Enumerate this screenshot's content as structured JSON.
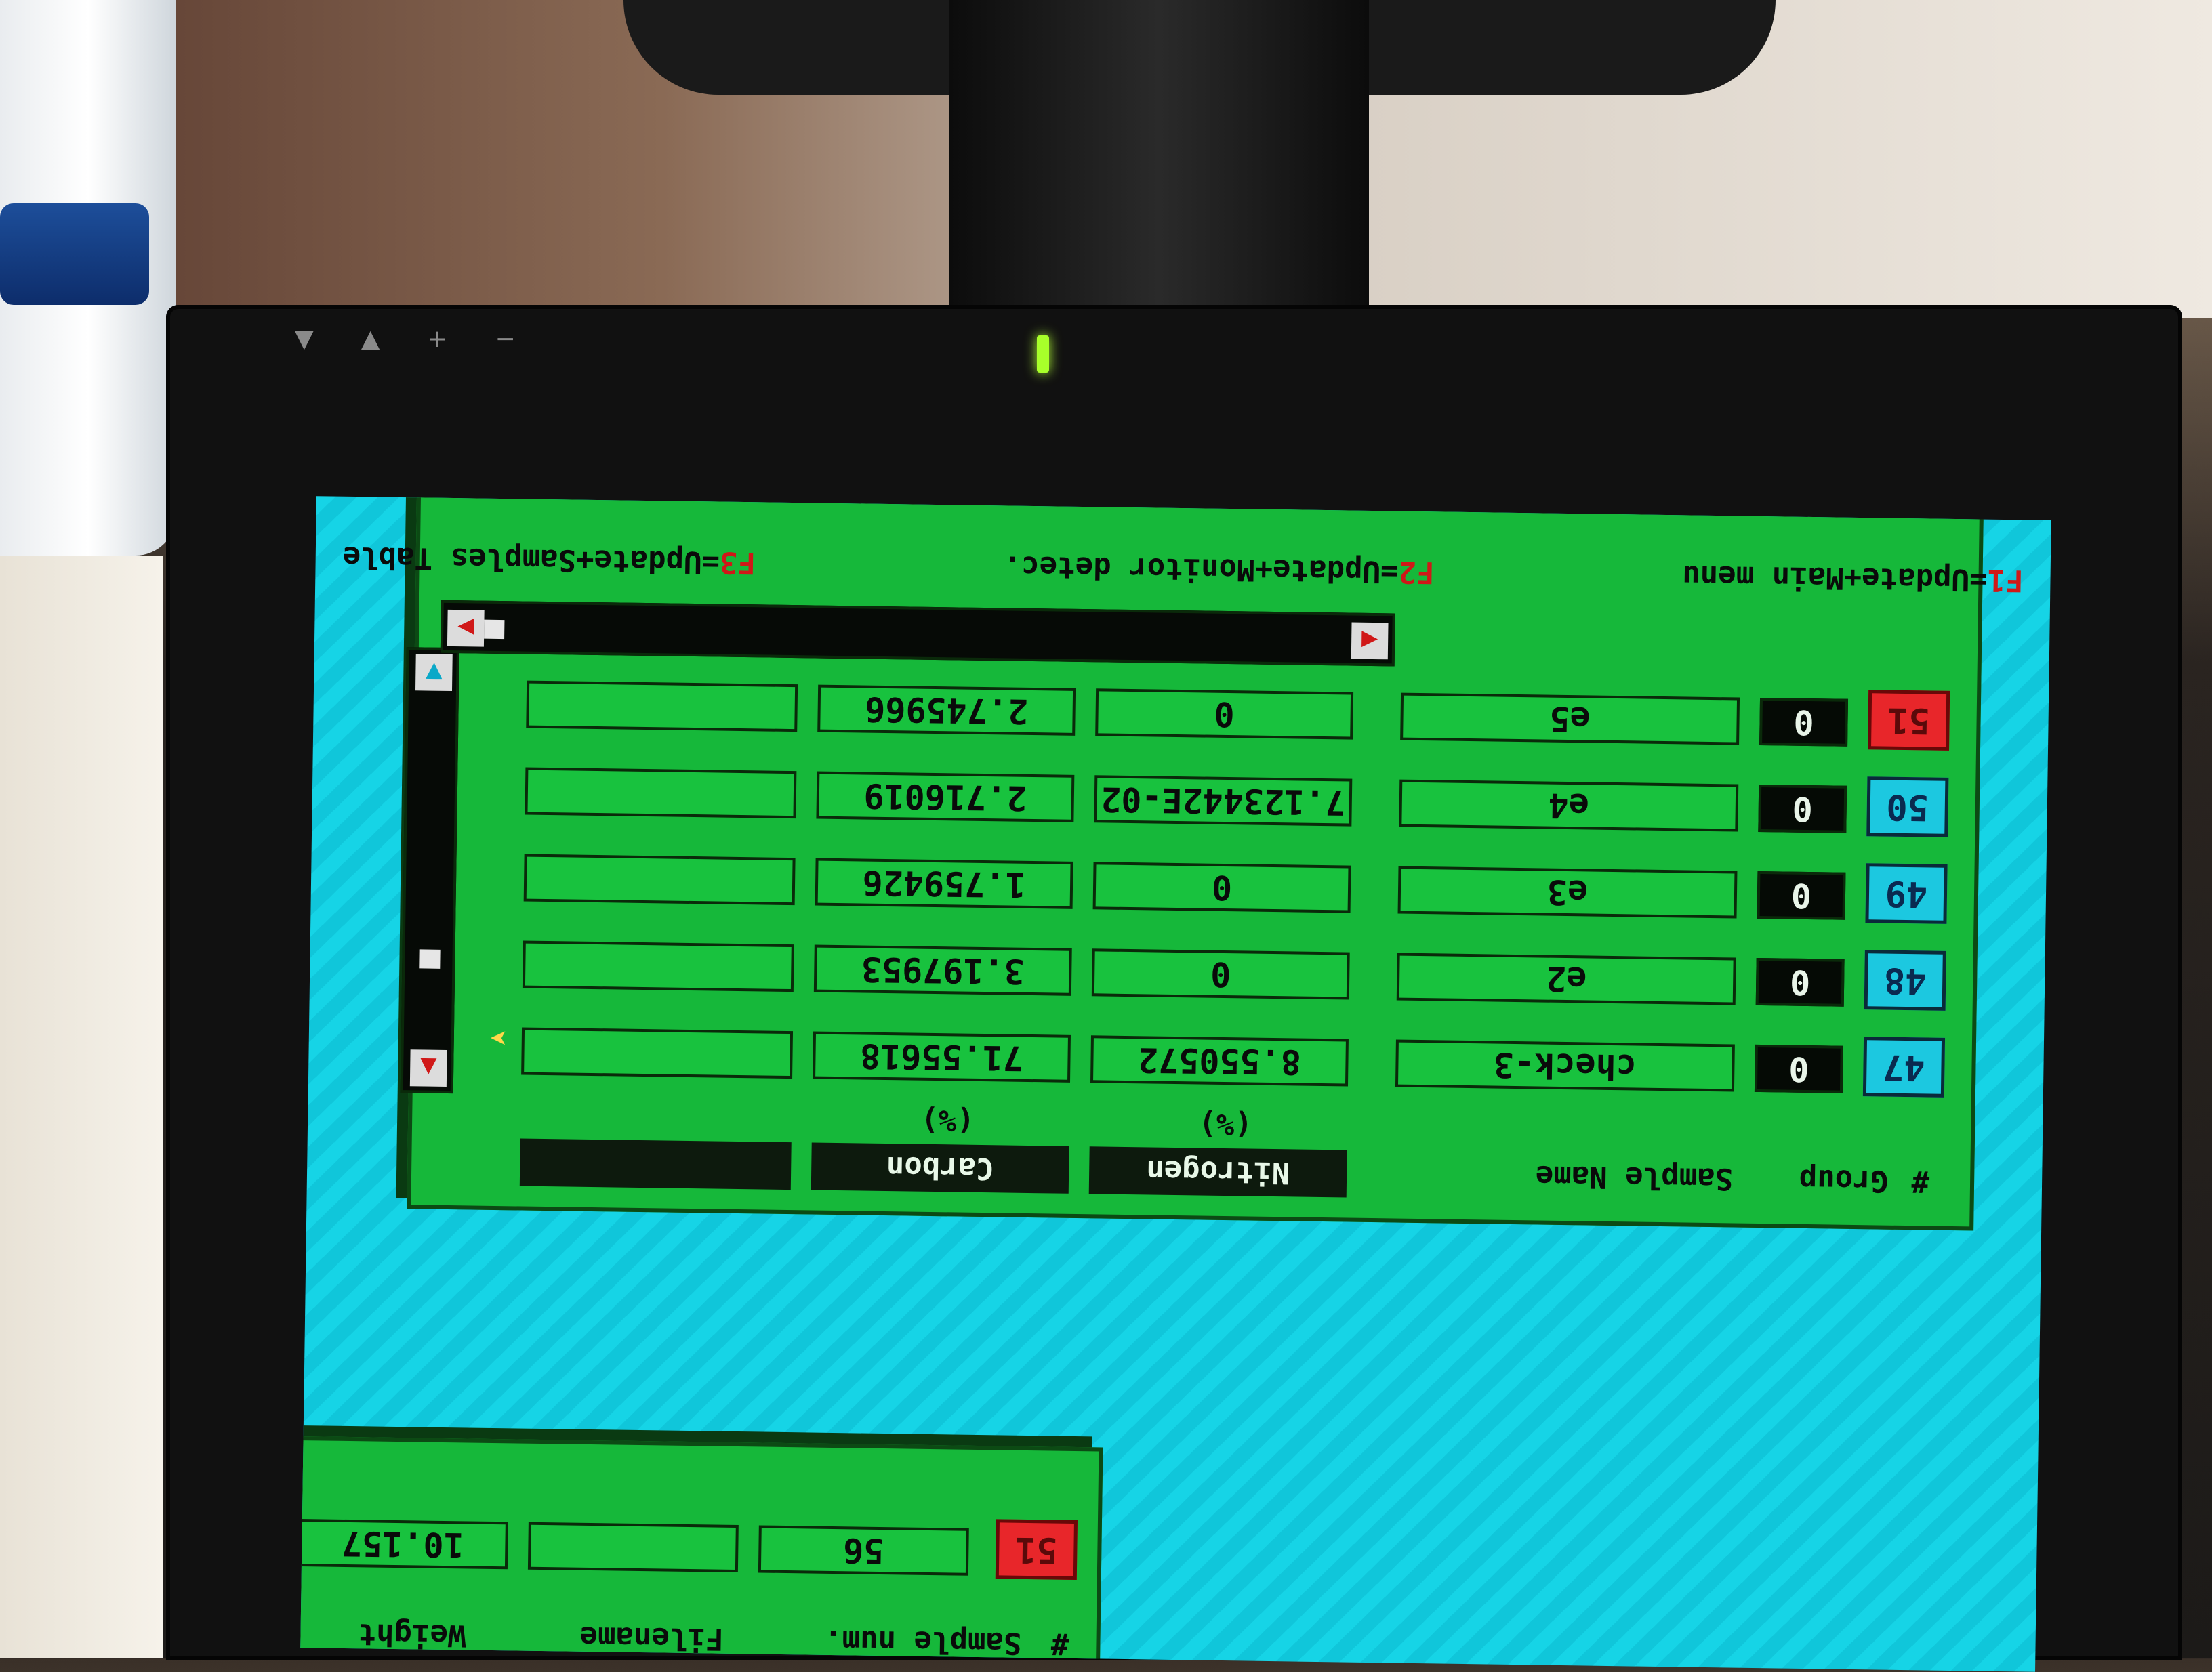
{
  "function_keys": [
    {
      "key": "F1",
      "text": "=Update+Main menu"
    },
    {
      "key": "F2",
      "text": "=Update+Monitor detec."
    },
    {
      "key": "F3",
      "text": "=Update+Samples Table"
    }
  ],
  "table": {
    "headers": {
      "num": "#",
      "group": "Group",
      "sample_name": "Sample Name",
      "col1": "Nitrogen",
      "col1_unit": "(%)",
      "col2": "Carbon",
      "col2_unit": "(%)",
      "col3": ""
    },
    "rows": [
      {
        "num": "47",
        "group": "0",
        "name": "check-3",
        "nitrogen": "8.550572",
        "carbon": "71.55618",
        "col3": "",
        "active": false
      },
      {
        "num": "48",
        "group": "0",
        "name": "e2",
        "nitrogen": "0",
        "carbon": "3.197953",
        "col3": "",
        "active": false
      },
      {
        "num": "49",
        "group": "0",
        "name": "e3",
        "nitrogen": "0",
        "carbon": "1.759426",
        "col3": "",
        "active": false
      },
      {
        "num": "50",
        "group": "0",
        "name": "e4",
        "nitrogen": "7.123442E-02",
        "carbon": "2.716019",
        "col3": "",
        "active": false
      },
      {
        "num": "51",
        "group": "0",
        "name": "e5",
        "nitrogen": "0",
        "carbon": "2.745966",
        "col3": "",
        "active": true
      }
    ]
  },
  "lower_panel": {
    "headers": {
      "num": "#",
      "sample": "Sample num.",
      "filename": "Filename",
      "weight": "Weight"
    },
    "row": {
      "num": "51",
      "sample": "56",
      "filename": "",
      "weight": "10.157"
    }
  },
  "icons": {
    "scroll_up": "up-arrow-icon",
    "scroll_down": "down-arrow-icon",
    "scroll_left": "left-arrow-icon",
    "scroll_right": "right-arrow-icon"
  },
  "colors": {
    "screen_bg": "#16d4e6",
    "panel_bg": "#16b83a",
    "active_row": "#e8262a",
    "row_num": "#1cc8e0",
    "fkey": "#d01818"
  }
}
